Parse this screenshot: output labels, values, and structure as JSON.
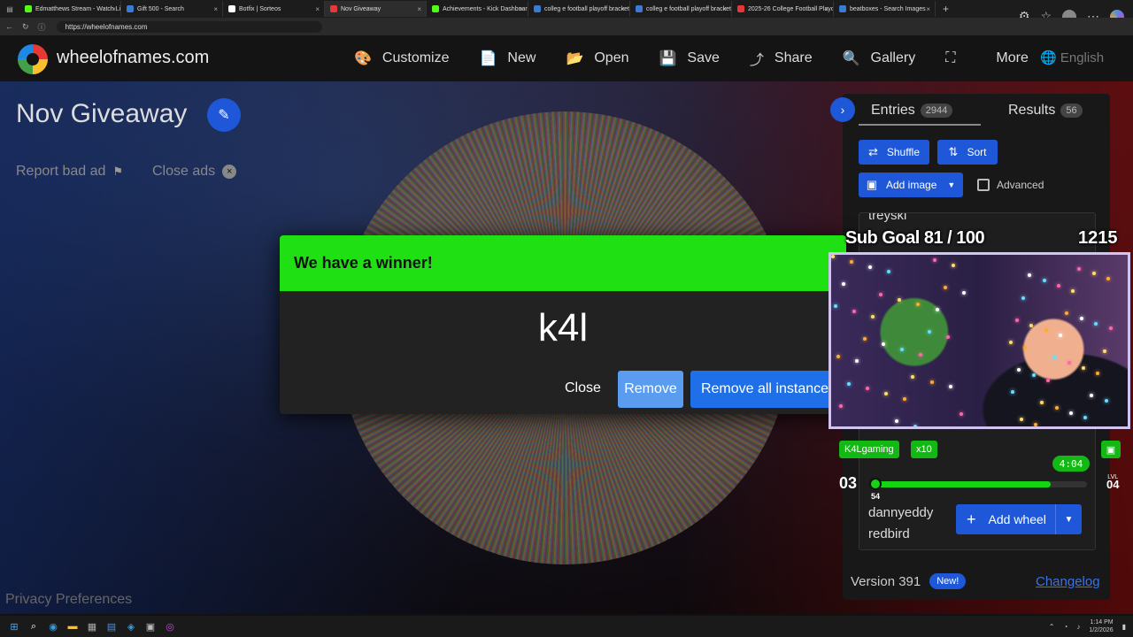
{
  "browser": {
    "tabs": [
      {
        "title": "Edmatthews Stream - Watch Liv",
        "color": "#53fc18"
      },
      {
        "title": "Gift 500 - Search",
        "color": "#3a7bd5"
      },
      {
        "title": "Botfix | Sorteos",
        "color": "#ffffff"
      },
      {
        "title": "Nov Giveaway",
        "color": "#e53935",
        "active": true
      },
      {
        "title": "Achievements - Kick Dashboard",
        "color": "#53fc18"
      },
      {
        "title": "colleg e football playoff bracket",
        "color": "#3a7bd5"
      },
      {
        "title": "colleg e football playoff bracket",
        "color": "#3a7bd5"
      },
      {
        "title": "2025-26 College Football Playoff",
        "color": "#e53935"
      },
      {
        "title": "beatboxes - Search Images",
        "color": "#3a7bd5"
      }
    ],
    "url": "https://wheelofnames.com"
  },
  "header": {
    "site_name": "wheelofnames.com",
    "menu": [
      {
        "icon": "palette-icon",
        "glyph": "🎨",
        "label": "Customize"
      },
      {
        "icon": "file-icon",
        "glyph": "📄",
        "label": "New"
      },
      {
        "icon": "folder-open-icon",
        "glyph": "📂",
        "label": "Open"
      },
      {
        "icon": "save-icon",
        "glyph": "💾",
        "label": "Save"
      },
      {
        "icon": "share-icon",
        "glyph": "⤴",
        "label": "Share"
      },
      {
        "icon": "search-icon",
        "glyph": "🔍",
        "label": "Gallery"
      },
      {
        "icon": "fullscreen-icon",
        "glyph": "⛶",
        "label": ""
      },
      {
        "icon": "more-icon",
        "glyph": "",
        "label": "More"
      }
    ],
    "language": "English"
  },
  "wheel": {
    "title": "Nov Giveaway",
    "report_ad": "Report bad ad",
    "close_ads": "Close ads",
    "privacy": "Privacy Preferences"
  },
  "panel": {
    "entries_label": "Entries",
    "entries_count": "2944",
    "results_label": "Results",
    "results_count": "56",
    "shuffle": "Shuffle",
    "sort": "Sort",
    "add_image": "Add image",
    "advanced": "Advanced",
    "entries": [
      "treyski",
      "dannyeddy",
      "redbird"
    ],
    "add_wheel": "Add wheel",
    "version": "Version 391",
    "new_badge": "New!",
    "changelog": "Changelog"
  },
  "dialog": {
    "title": "We have a winner!",
    "winner": "k4l",
    "close": "Close",
    "remove": "Remove",
    "remove_all": "Remove all instances"
  },
  "overlay": {
    "sub_goal": "Sub Goal  81 / 100",
    "counter": "1215",
    "tag_name": "K4Lgaming",
    "tag_mult": "x10",
    "timer": "4:04",
    "level": "03",
    "xp": "54",
    "xp_progress": 0.83,
    "lvl_label": "LVL",
    "lvl_next": "04"
  },
  "taskbar": {
    "time": "1:14 PM",
    "date": "1/2/2026"
  },
  "colors": {
    "accent": "#1e57d8",
    "winner_header": "#1ee013",
    "overlay_green": "#14b814"
  }
}
